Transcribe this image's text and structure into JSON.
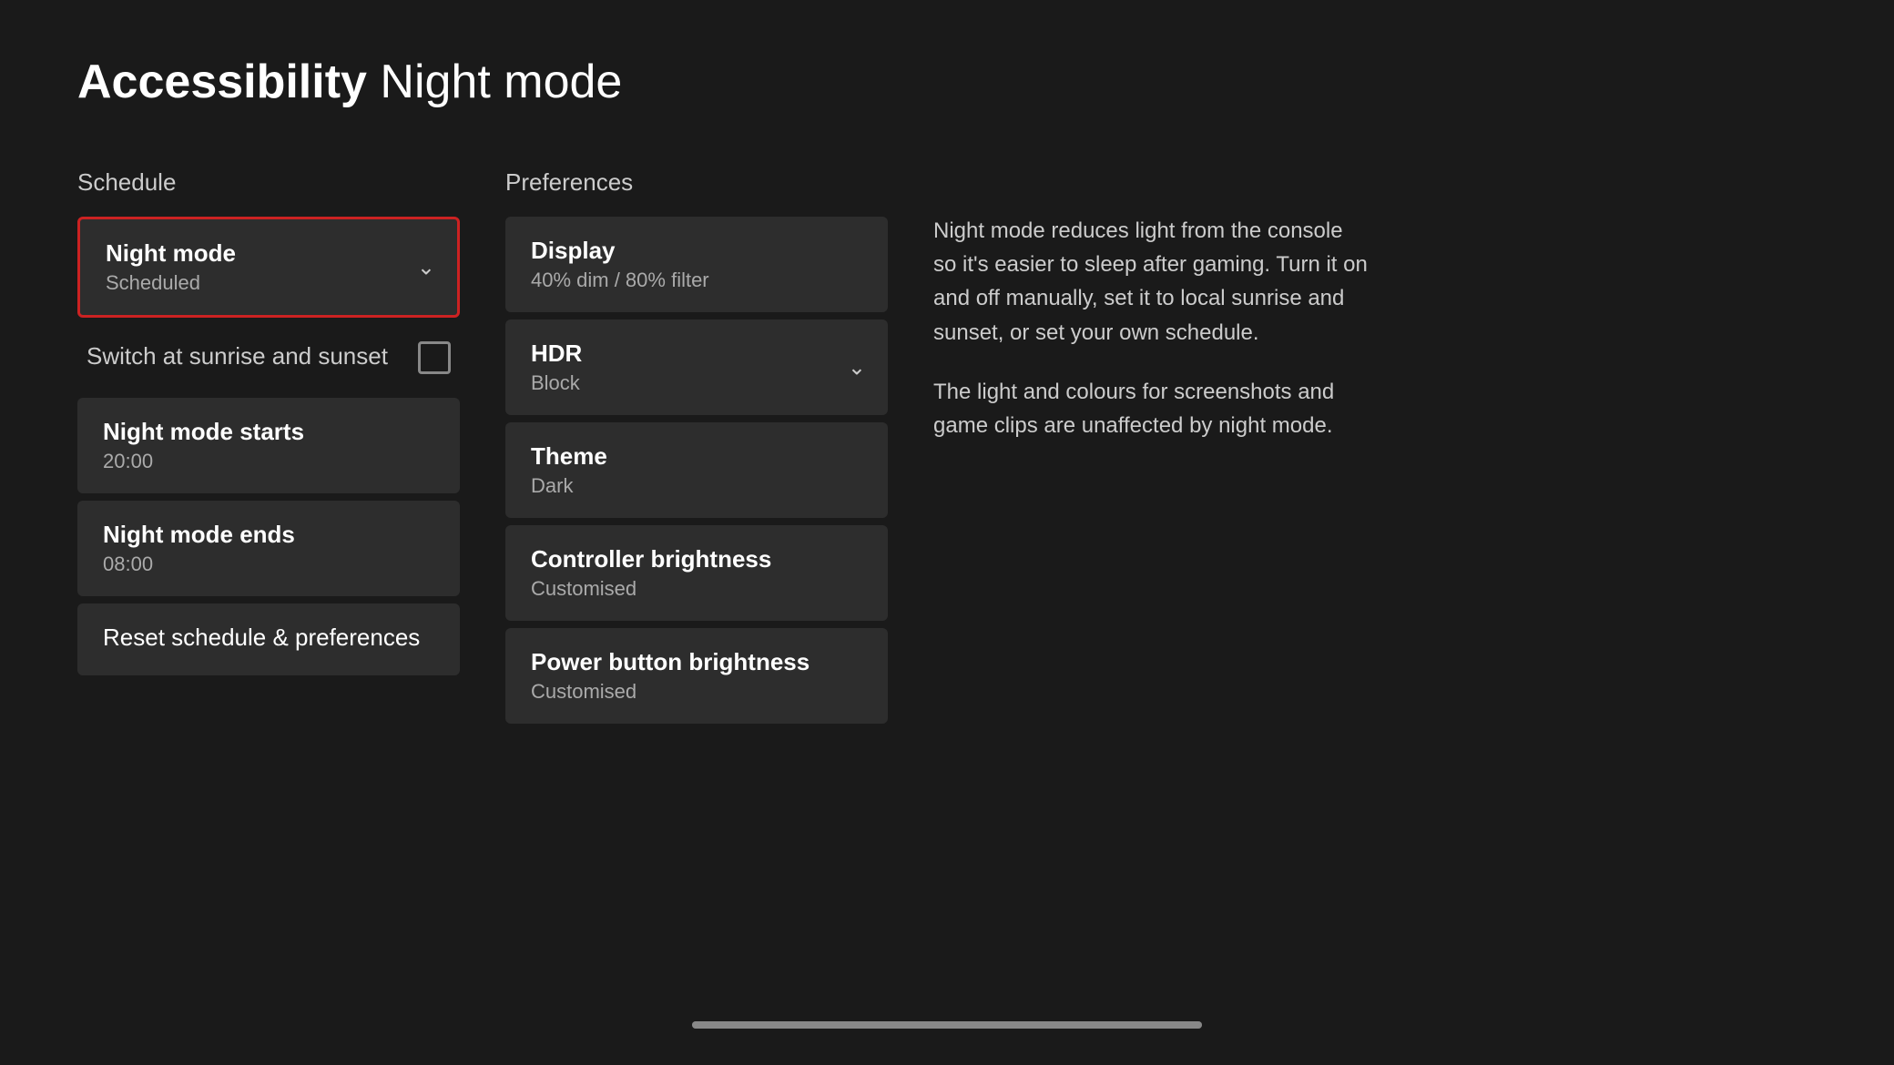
{
  "header": {
    "breadcrumb_bold": "Accessibility",
    "breadcrumb_light": "Night mode"
  },
  "schedule": {
    "section_title": "Schedule",
    "night_mode_title": "Night mode",
    "night_mode_subtitle": "Scheduled",
    "sunrise_sunset_label": "Switch at sunrise and sunset",
    "night_mode_starts_title": "Night mode starts",
    "night_mode_starts_value": "20:00",
    "night_mode_ends_title": "Night mode ends",
    "night_mode_ends_value": "08:00",
    "reset_label": "Reset schedule & preferences"
  },
  "preferences": {
    "section_title": "Preferences",
    "display_title": "Display",
    "display_subtitle": "40% dim / 80% filter",
    "hdr_title": "HDR",
    "hdr_subtitle": "Block",
    "theme_title": "Theme",
    "theme_subtitle": "Dark",
    "controller_brightness_title": "Controller brightness",
    "controller_brightness_subtitle": "Customised",
    "power_button_brightness_title": "Power button brightness",
    "power_button_brightness_subtitle": "Customised"
  },
  "info": {
    "paragraph1": "Night mode reduces light from the console so it's easier to sleep after gaming. Turn it on and off manually, set it to local sunrise and sunset, or set your own schedule.",
    "paragraph2": "The light and colours for screenshots and game clips are unaffected by night mode."
  },
  "icons": {
    "chevron_down": "⌄"
  }
}
